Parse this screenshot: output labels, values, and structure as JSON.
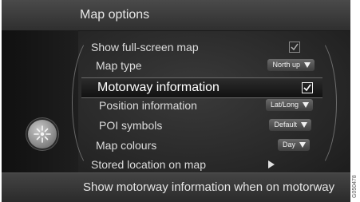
{
  "header": {
    "title": "Map options"
  },
  "menu": {
    "items": [
      {
        "label": "Show full-screen map",
        "control": "checkbox",
        "checked": true
      },
      {
        "label": "Map type",
        "control": "dropdown",
        "value": "North up"
      },
      {
        "label": "Motorway information",
        "control": "checkbox",
        "checked": true,
        "selected": true
      },
      {
        "label": "Position information",
        "control": "dropdown",
        "value": "Lat/Long"
      },
      {
        "label": "POI symbols",
        "control": "dropdown",
        "value": "Default"
      },
      {
        "label": "Map colours",
        "control": "dropdown",
        "value": "Day"
      },
      {
        "label": "Stored location on map",
        "control": "submenu"
      }
    ]
  },
  "footer": {
    "help_text": "Show motorway information when on motorway"
  },
  "left_panel": {
    "icon": "compass-icon"
  },
  "ref_code": "G050478"
}
